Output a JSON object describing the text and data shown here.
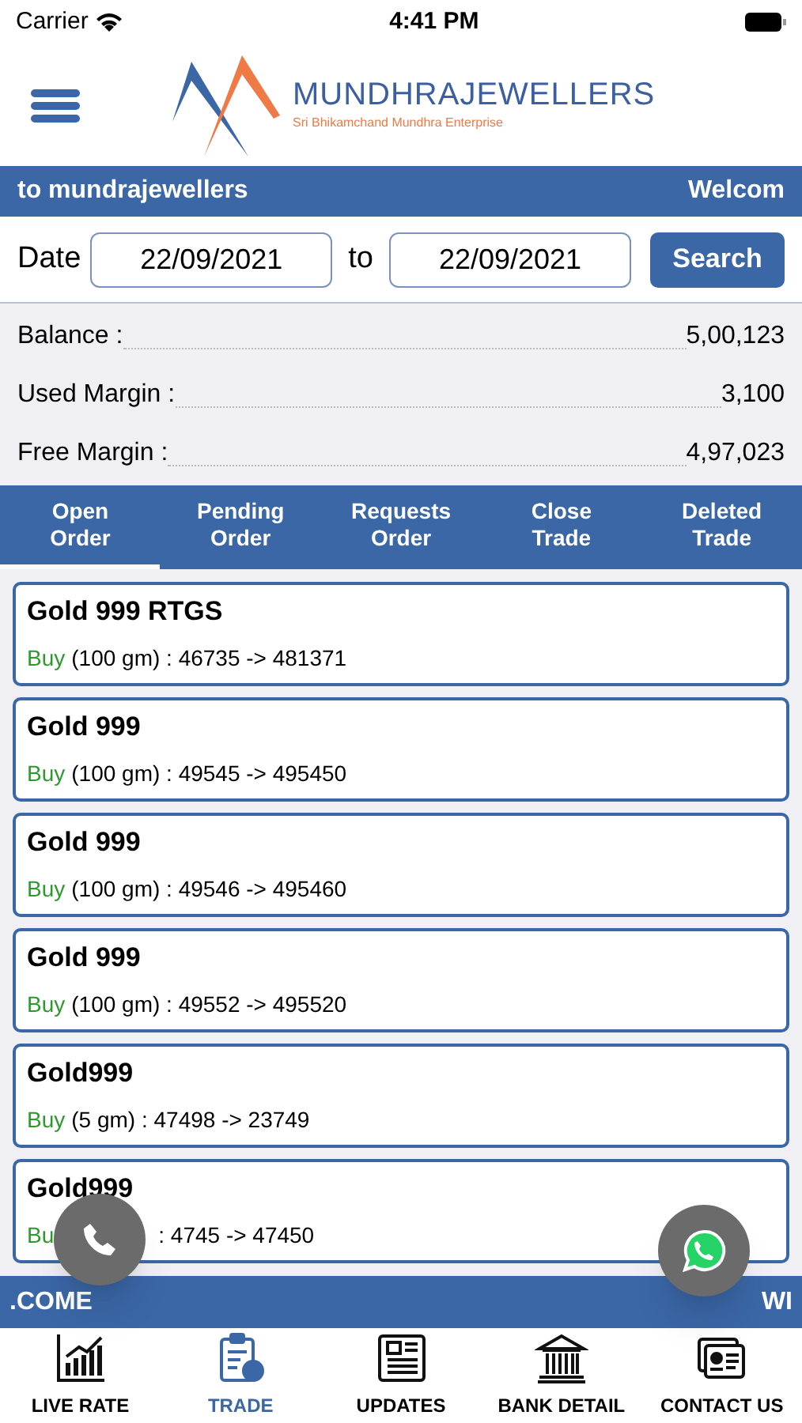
{
  "status_bar": {
    "carrier": "Carrier",
    "time": "4:41 PM"
  },
  "logo": {
    "name": "MUNDHRAJEWELLERS",
    "tagline": "Sri Bhikamchand Mundhra Enterprise"
  },
  "ticker_top": {
    "left": "to mundrajewellers",
    "right": "Welcom"
  },
  "date_filter": {
    "label": "Date",
    "from": "22/09/2021",
    "separator": "to",
    "to": "22/09/2021",
    "button": "Search"
  },
  "summary": [
    {
      "label": "Balance :",
      "value": "5,00,123"
    },
    {
      "label": "Used Margin :",
      "value": "3,100"
    },
    {
      "label": "Free Margin :",
      "value": "4,97,023"
    }
  ],
  "tabs": [
    {
      "line1": "Open",
      "line2": "Order",
      "selected": true
    },
    {
      "line1": "Pending",
      "line2": "Order",
      "selected": false
    },
    {
      "line1": "Requests",
      "line2": "Order",
      "selected": false
    },
    {
      "line1": "Close",
      "line2": "Trade",
      "selected": false
    },
    {
      "line1": "Deleted",
      "line2": "Trade",
      "selected": false
    }
  ],
  "orders": [
    {
      "title": "Gold 999 RTGS",
      "side": "Buy",
      "detail": "(100 gm) : 46735 -> 481371",
      "covered": false
    },
    {
      "title": "Gold 999",
      "side": "Buy",
      "detail": "(100 gm) : 49545 -> 495450",
      "covered": false
    },
    {
      "title": "Gold 999",
      "side": "Buy",
      "detail": "(100 gm) : 49546 -> 495460",
      "covered": false
    },
    {
      "title": "Gold 999",
      "side": "Buy",
      "detail": "(100 gm) : 49552 -> 495520",
      "covered": false
    },
    {
      "title": "Gold999",
      "side": "Buy",
      "detail": "(5 gm) : 47498 -> 23749",
      "covered": false
    },
    {
      "title": "Gold999",
      "side": "Bu",
      "detail": ": 4745 -> 47450",
      "covered": true
    }
  ],
  "ticker_bottom": {
    "left": ".COME",
    "right": "WI"
  },
  "bottom_nav": [
    {
      "label": "LIVE RATE",
      "kind": "chart",
      "selected": false
    },
    {
      "label": "TRADE",
      "kind": "clipboard",
      "selected": true
    },
    {
      "label": "UPDATES",
      "kind": "news",
      "selected": false
    },
    {
      "label": "BANK DETAIL",
      "kind": "bank",
      "selected": false
    },
    {
      "label": "CONTACT US",
      "kind": "contact",
      "selected": false
    }
  ]
}
